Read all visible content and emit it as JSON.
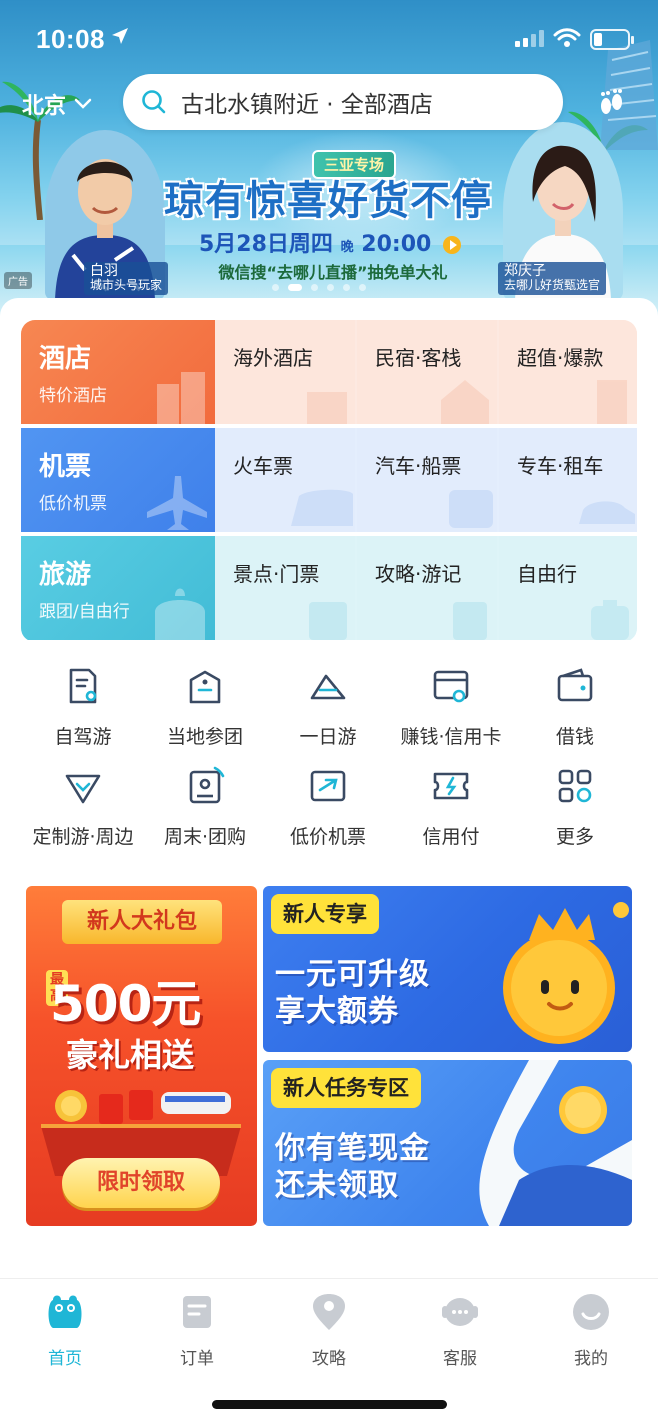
{
  "status": {
    "time": "10:08"
  },
  "header": {
    "city": "北京",
    "search_text": "古北水镇附近 · 全部酒店"
  },
  "banner": {
    "badge": "三亚专场",
    "title": "琼有惊喜好货不停",
    "date_prefix": "5月28日周四",
    "date_evening": "晚",
    "date_time": "20:00",
    "subtitle": "微信搜“去哪儿直播”抽免单大礼",
    "left_person_name": "白羽",
    "left_person_role": "城市头号玩家",
    "right_person_name": "郑庆子",
    "right_person_role": "去哪儿好货甄选官",
    "ad_label": "广告"
  },
  "services": [
    {
      "title": "酒店",
      "subtitle": "特价酒店",
      "cells": [
        "海外酒店",
        "民宿·客栈",
        "超值·爆款"
      ],
      "main_color": "#f47b45",
      "cell_color": "#fde9e1"
    },
    {
      "title": "机票",
      "subtitle": "低价机票",
      "cells": [
        "火车票",
        "汽车·船票",
        "专车·租车"
      ],
      "main_color": "#4a8ef0",
      "cell_color": "#e4eefd"
    },
    {
      "title": "旅游",
      "subtitle": "跟团/自由行",
      "cells": [
        "景点·门票",
        "攻略·游记",
        "自由行"
      ],
      "main_color": "#4fc7dd",
      "cell_color": "#def4f8"
    }
  ],
  "quick": [
    {
      "icon": "self-drive-icon",
      "label": "自驾游"
    },
    {
      "icon": "local-tour-icon",
      "label": "当地参团"
    },
    {
      "icon": "day-trip-icon",
      "label": "一日游"
    },
    {
      "icon": "credit-card-icon",
      "label": "赚钱·信用卡"
    },
    {
      "icon": "wallet-icon",
      "label": "借钱"
    },
    {
      "icon": "custom-tour-icon",
      "label": "定制游·周边"
    },
    {
      "icon": "group-buy-icon",
      "label": "周末·团购"
    },
    {
      "icon": "flight-ticket-icon",
      "label": "低价机票"
    },
    {
      "icon": "credit-pay-icon",
      "label": "信用付"
    },
    {
      "icon": "more-grid-icon",
      "label": "更多"
    }
  ],
  "promos": {
    "gift": {
      "ribbon": "新人大礼包",
      "max_tag": "最高",
      "amount": "500元",
      "text": "豪礼相送",
      "button": "限时领取"
    },
    "upgrade": {
      "tag": "新人专享",
      "line1": "一元可升级",
      "line2": "享大额券"
    },
    "task": {
      "tag": "新人任务专区",
      "line1": "你有笔现金",
      "line2": "还未领取"
    }
  },
  "tabs": [
    {
      "icon": "home-icon",
      "label": "首页",
      "active": true
    },
    {
      "icon": "order-icon",
      "label": "订单",
      "active": false
    },
    {
      "icon": "guide-icon",
      "label": "攻略",
      "active": false
    },
    {
      "icon": "service-icon",
      "label": "客服",
      "active": false
    },
    {
      "icon": "profile-icon",
      "label": "我的",
      "active": false
    }
  ],
  "colors": {
    "accent": "#1fb6d6",
    "icon_stroke": "#3a4a63"
  }
}
